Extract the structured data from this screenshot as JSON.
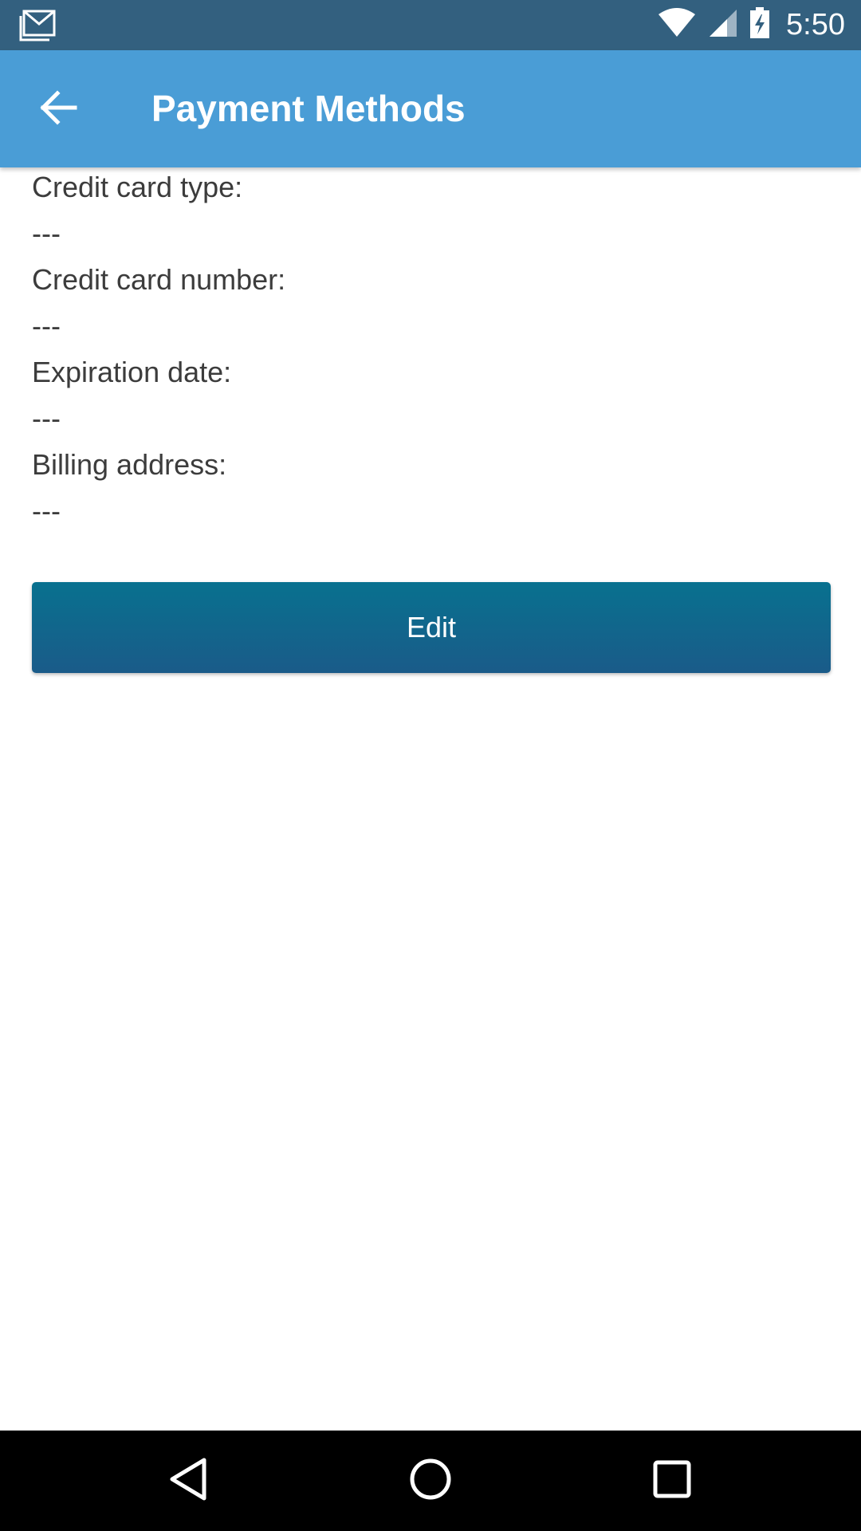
{
  "status_bar": {
    "time": "5:50",
    "color": "#33607f",
    "icons": [
      "gmail-notification-icon",
      "wifi-icon",
      "cellular-signal-icon",
      "battery-charging-icon"
    ]
  },
  "app_bar": {
    "title": "Payment Methods",
    "color": "#4a9dd6",
    "back_icon": "arrow-back-icon"
  },
  "fields": [
    {
      "label": "Credit card type:",
      "value": "---"
    },
    {
      "label": "Credit card number:",
      "value": "---"
    },
    {
      "label": "Expiration date:",
      "value": "---"
    },
    {
      "label": "Billing address:",
      "value": "---"
    }
  ],
  "edit_button": {
    "label": "Edit",
    "color": "#1a6a8c"
  },
  "nav_bar": {
    "icons": [
      "nav-back-icon",
      "nav-home-icon",
      "nav-recents-icon"
    ]
  }
}
